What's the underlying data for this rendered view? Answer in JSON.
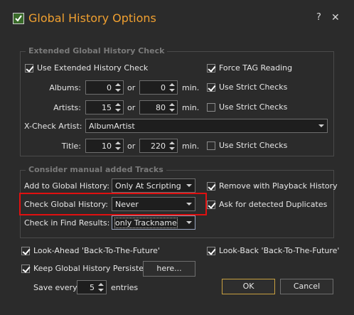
{
  "window": {
    "title": "Global History Options",
    "help_label": "?",
    "close_label": "✕"
  },
  "extended": {
    "group_title": "Extended Global History Check",
    "use_extended": {
      "label": "Use Extended History Check",
      "checked": true
    },
    "force_tag": {
      "label": "Force TAG Reading",
      "checked": true
    },
    "albums": {
      "label": "Albums:",
      "min": "0",
      "max": "0",
      "or": "or",
      "unit": "min.",
      "strict_label": "Use Strict Checks",
      "strict_checked": true
    },
    "artists": {
      "label": "Artists:",
      "min": "15",
      "max": "80",
      "or": "or",
      "unit": "min.",
      "strict_label": "Use Strict Checks",
      "strict_checked": false
    },
    "xcheck": {
      "label": "X-Check Artist:",
      "value": "AlbumArtist"
    },
    "title_row": {
      "label": "Title:",
      "min": "10",
      "max": "220",
      "or": "or",
      "unit": "min.",
      "strict_label": "Use Strict Checks",
      "strict_checked": false
    }
  },
  "manual": {
    "group_title": "Consider manual added Tracks",
    "add_to": {
      "label": "Add to Global History:",
      "value": "Only At Scripting"
    },
    "remove_playback": {
      "label": "Remove with Playback History",
      "checked": true
    },
    "check_global": {
      "label": "Check Global History:",
      "value": "Never"
    },
    "ask_duplicates": {
      "label": "Ask for detected Duplicates",
      "checked": true
    },
    "find_results": {
      "label": "Check in Find Results:",
      "value": "only Trackname"
    }
  },
  "bottom": {
    "look_ahead": {
      "label": "Look-Ahead 'Back-To-The-Future'",
      "checked": true
    },
    "look_back": {
      "label": "Look-Back 'Back-To-The-Future'",
      "checked": true
    },
    "keep_persistent": {
      "label": "Keep Global History Persistent",
      "checked": true
    },
    "here_label": "here...",
    "save_every_label": "Save every",
    "save_every_value": "5",
    "entries_label": "entries",
    "ok_label": "OK",
    "cancel_label": "Cancel"
  },
  "colors": {
    "accent_title": "#f0a030",
    "highlight": "#e01010",
    "background": "#2b2b2b"
  }
}
